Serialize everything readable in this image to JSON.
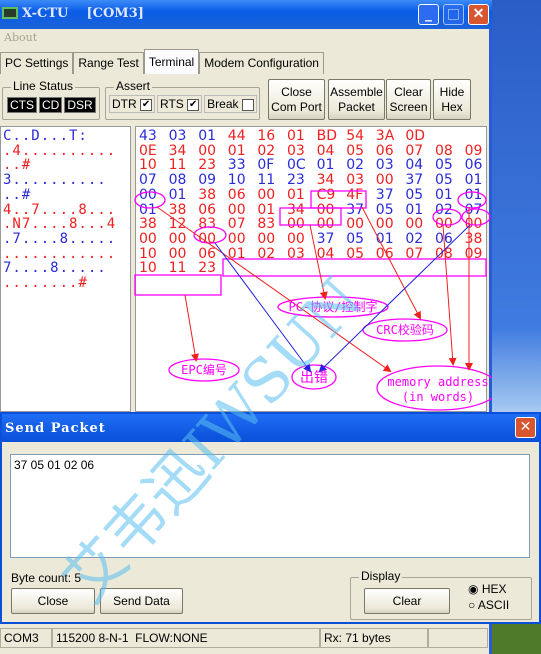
{
  "window": {
    "title": "X-CTU    [COM3]",
    "menu": "About"
  },
  "tabs": [
    {
      "label": "PC Settings"
    },
    {
      "label": "Range Test"
    },
    {
      "label": "Terminal",
      "active": true
    },
    {
      "label": "Modem Configuration"
    }
  ],
  "line_status": {
    "label": "Line Status",
    "indicators": [
      "CTS",
      "CD",
      "DSR"
    ]
  },
  "assert": {
    "label": "Assert",
    "dtr": "DTR",
    "dtr_checked": true,
    "rts": "RTS",
    "rts_checked": true,
    "brk": "Break",
    "brk_checked": false
  },
  "toolbar": {
    "close_port": [
      "Close",
      "Com Port"
    ],
    "assemble": [
      "Assemble",
      "Packet"
    ],
    "clear": [
      "Clear",
      "Screen"
    ],
    "hide": [
      "Hide",
      "Hex"
    ]
  },
  "colors": {
    "sent": "#2b2bd8",
    "received": "#f02020",
    "annotation": "#ff00ff"
  },
  "ascii_lines": [
    {
      "t": "C..D...T:",
      "c": "b"
    },
    {
      "t": ".4..........",
      "c": "r"
    },
    {
      "t": "..#",
      "c": "r"
    },
    {
      "t": "3..........",
      "c": "b"
    },
    {
      "t": "..#",
      "c": "b"
    },
    {
      "t": "4..7....8...",
      "c": "r"
    },
    {
      "t": ".N7....8...4",
      "c": "r"
    },
    {
      "t": ".7....8.....",
      "c": "b"
    },
    {
      "t": "............",
      "c": "r"
    },
    {
      "t": "7....8.....",
      "c": "b"
    },
    {
      "t": "........#",
      "c": "r"
    }
  ],
  "hex_rows": [
    "b43 b03 b01 r44 r16 r01 rBD r54 r3A r0D",
    "r0E r34 r00 r01 r02 r03 r04 r05 r06 r07 r08 r09",
    "r10 r11 r23 b33 b0F b0C b01 b02 b03 b04 b05 b06",
    "b07 b08 b09 b10 b11 b23 r34 r03 r00 b37 b05 b01",
    "b00 b01 r38 r06 r00 r01 rC9 r4F b37 b05 b01 b01",
    "b01 r38 r06 r00 r01 r34 r00 b37 b05 b01 b02 b07",
    "r38 r12 r83 r07 r83 r00 r00 r00 r00 r00 r00 r00",
    "r00 r00 r00 r00 r00 r00 b37 b05 b01 b02 b06 r38",
    "r10 r00 r06 r01 r02 r03 r04 r05 r06 r07 r08 r09",
    "r10 r11 r23"
  ],
  "annotations": {
    "pc": "PC-协议/控制字",
    "crc": "CRC校验码",
    "epc": "EPC编号",
    "error": "出错",
    "mem1": "memory address",
    "mem2": "(in words)"
  },
  "watermark": "艾韦迅IWSUN",
  "send_packet": {
    "title": "Send Packet",
    "value": "37 05 01 02 06",
    "byte_count": "Byte count: 5",
    "close": "Close",
    "send": "Send Data",
    "display": "Display",
    "clear": "Clear",
    "hex": "HEX",
    "ascii": "ASCII",
    "mode": "HEX"
  },
  "statusbar": {
    "port": "COM3",
    "settings": "115200 8-N-1  FLOW:NONE",
    "rx": "Rx: 71 bytes",
    "extra": ""
  }
}
